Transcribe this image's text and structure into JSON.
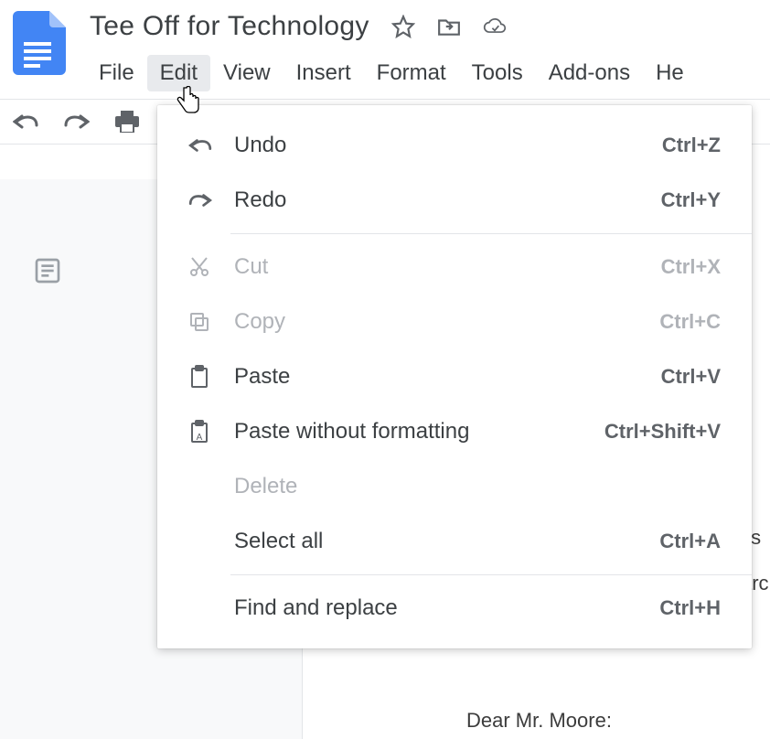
{
  "doc_title": "Tee Off for Technology",
  "menu": {
    "file": "File",
    "edit": "Edit",
    "view": "View",
    "insert": "Insert",
    "format": "Format",
    "tools": "Tools",
    "addons": "Add-ons",
    "help": "He"
  },
  "edit_menu": {
    "undo": {
      "label": "Undo",
      "shortcut": "Ctrl+Z"
    },
    "redo": {
      "label": "Redo",
      "shortcut": "Ctrl+Y"
    },
    "cut": {
      "label": "Cut",
      "shortcut": "Ctrl+X"
    },
    "copy": {
      "label": "Copy",
      "shortcut": "Ctrl+C"
    },
    "paste": {
      "label": "Paste",
      "shortcut": "Ctrl+V"
    },
    "paste_nofmt": {
      "label": "Paste without formatting",
      "shortcut": "Ctrl+Shift+V"
    },
    "delete": {
      "label": "Delete"
    },
    "select_all": {
      "label": "Select all",
      "shortcut": "Ctrl+A"
    },
    "find_replace": {
      "label": "Find and replace",
      "shortcut": "Ctrl+H"
    }
  },
  "document_body": {
    "line1": "ıs",
    "line2": "arc",
    "line3": "Dear Mr. Moore:"
  }
}
